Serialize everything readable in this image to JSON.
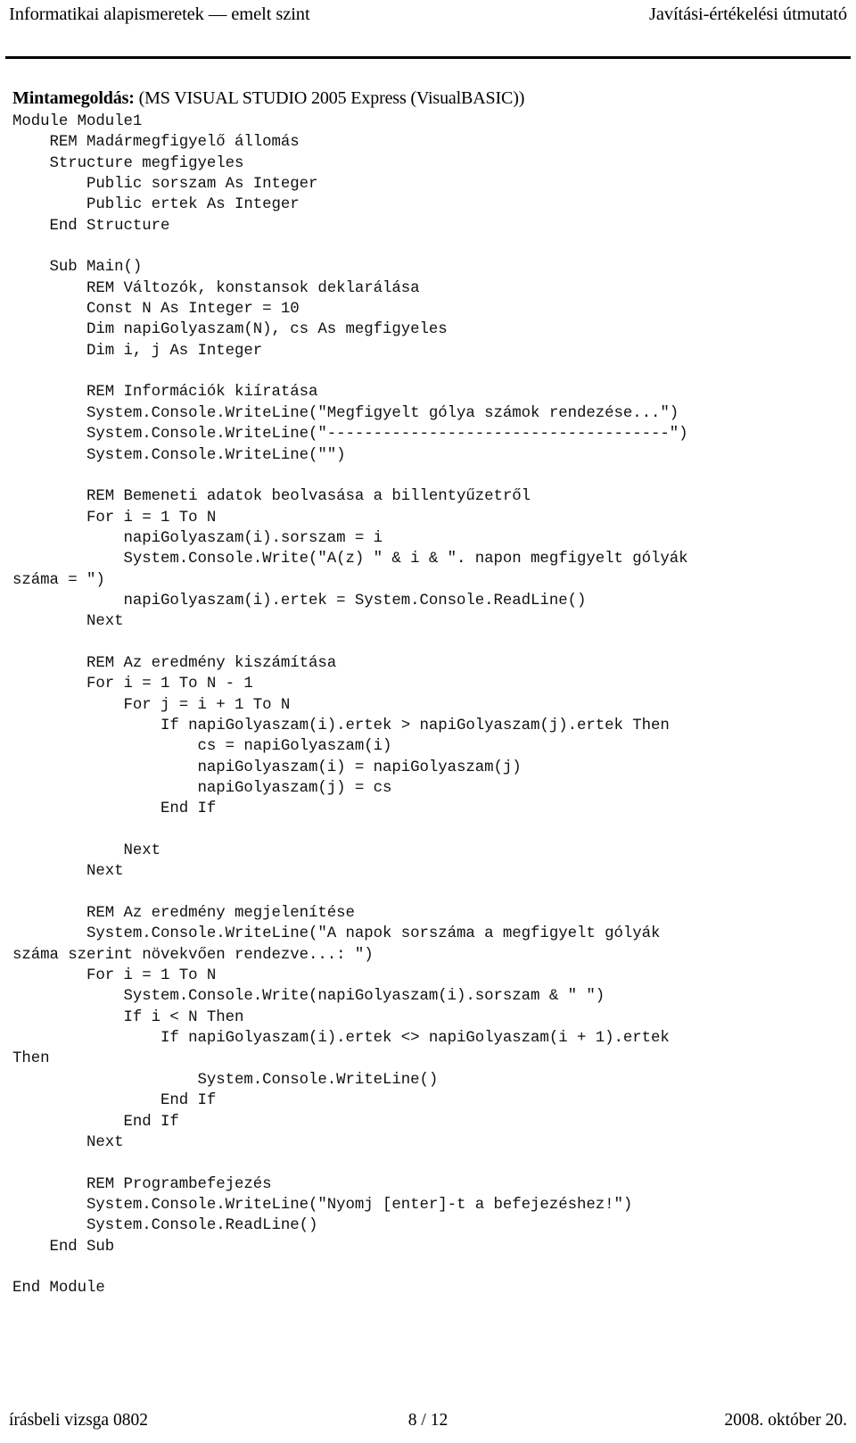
{
  "header": {
    "left": "Informatikai alapismeretek — emelt szint",
    "right": "Javítási-értékelési útmutató"
  },
  "solution": {
    "label_bold": "Mintamegoldás:",
    "label_rest": " (MS VISUAL STUDIO 2005 Express (VisualBASIC))"
  },
  "code": {
    "language": "VisualBASIC",
    "lines": [
      "Module Module1",
      "    REM Madármegfigyelő állomás",
      "    Structure megfigyeles",
      "        Public sorszam As Integer",
      "        Public ertek As Integer",
      "    End Structure",
      "",
      "    Sub Main()",
      "        REM Változók, konstansok deklarálása",
      "        Const N As Integer = 10",
      "        Dim napiGolyaszam(N), cs As megfigyeles",
      "        Dim i, j As Integer",
      "",
      "        REM Információk kiíratása",
      "        System.Console.WriteLine(\"Megfigyelt gólya számok rendezése...\")",
      "        System.Console.WriteLine(\"-------------------------------------\")",
      "        System.Console.WriteLine(\"\")",
      "",
      "        REM Bemeneti adatok beolvasása a billentyűzetről",
      "        For i = 1 To N",
      "            napiGolyaszam(i).sorszam = i",
      "            System.Console.Write(\"A(z) \" & i & \". napon megfigyelt gólyák",
      "száma = \")",
      "            napiGolyaszam(i).ertek = System.Console.ReadLine()",
      "        Next",
      "",
      "        REM Az eredmény kiszámítása",
      "        For i = 1 To N - 1",
      "            For j = i + 1 To N",
      "                If napiGolyaszam(i).ertek > napiGolyaszam(j).ertek Then",
      "                    cs = napiGolyaszam(i)",
      "                    napiGolyaszam(i) = napiGolyaszam(j)",
      "                    napiGolyaszam(j) = cs",
      "                End If",
      "",
      "            Next",
      "        Next",
      "",
      "        REM Az eredmény megjelenítése",
      "        System.Console.WriteLine(\"A napok sorszáma a megfigyelt gólyák",
      "száma szerint növekvően rendezve...: \")",
      "        For i = 1 To N",
      "            System.Console.Write(napiGolyaszam(i).sorszam & \" \")",
      "            If i < N Then",
      "                If napiGolyaszam(i).ertek <> napiGolyaszam(i + 1).ertek",
      "Then",
      "                    System.Console.WriteLine()",
      "                End If",
      "            End If",
      "        Next",
      "",
      "        REM Programbefejezés",
      "        System.Console.WriteLine(\"Nyomj [enter]-t a befejezéshez!\")",
      "        System.Console.ReadLine()",
      "    End Sub",
      "",
      "End Module"
    ]
  },
  "footer": {
    "left": "írásbeli vizsga 0802",
    "center": "8 / 12",
    "right": "2008. október 20."
  }
}
